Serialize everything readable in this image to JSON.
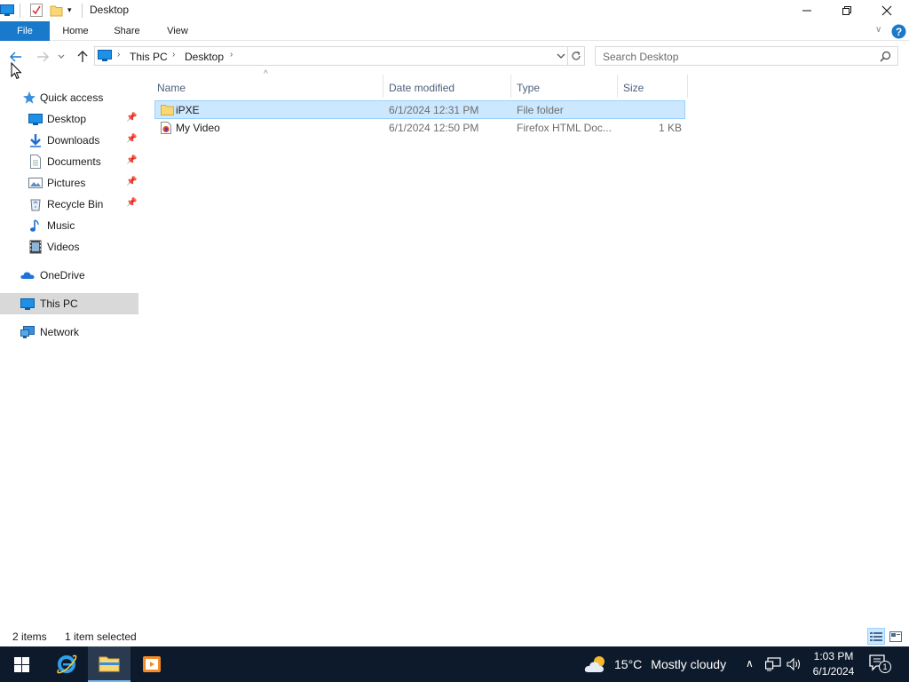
{
  "window": {
    "title": "Desktop"
  },
  "ribbon": {
    "tabs": [
      {
        "label": "File"
      },
      {
        "label": "Home"
      },
      {
        "label": "Share"
      },
      {
        "label": "View"
      }
    ]
  },
  "nav": {
    "breadcrumb": [
      {
        "label": "This PC"
      },
      {
        "label": "Desktop"
      }
    ],
    "search_placeholder": "Search Desktop"
  },
  "sidebar": {
    "quick_access": "Quick access",
    "pinned": [
      {
        "label": "Desktop",
        "icon": "desktop-icon",
        "pinned": true
      },
      {
        "label": "Downloads",
        "icon": "downloads-icon",
        "pinned": true
      },
      {
        "label": "Documents",
        "icon": "documents-icon",
        "pinned": true
      },
      {
        "label": "Pictures",
        "icon": "pictures-icon",
        "pinned": true
      },
      {
        "label": "Recycle Bin",
        "icon": "recycle-bin-icon",
        "pinned": true
      },
      {
        "label": "Music",
        "icon": "music-icon",
        "pinned": false
      },
      {
        "label": "Videos",
        "icon": "videos-icon",
        "pinned": false
      }
    ],
    "onedrive": "OneDrive",
    "this_pc": "This PC",
    "network": "Network"
  },
  "columns": [
    {
      "label": "Name"
    },
    {
      "label": "Date modified"
    },
    {
      "label": "Type"
    },
    {
      "label": "Size"
    }
  ],
  "files": [
    {
      "name": "iPXE",
      "date": "6/1/2024 12:31 PM",
      "type": "File folder",
      "size": "",
      "icon": "folder-icon",
      "selected": true
    },
    {
      "name": "My Video",
      "date": "6/1/2024 12:50 PM",
      "type": "Firefox HTML Doc...",
      "size": "1 KB",
      "icon": "firefox-html-icon",
      "selected": false
    }
  ],
  "status": {
    "item_count": "2 items",
    "selection": "1 item selected"
  },
  "taskbar": {
    "weather_temp": "15°C",
    "weather_text": "Mostly cloudy",
    "time": "1:03 PM",
    "date": "6/1/2024",
    "notification_count": "1"
  },
  "colors": {
    "accent": "#1979ca",
    "selection": "#cce8ff",
    "taskbar": "#0c1a2b"
  }
}
